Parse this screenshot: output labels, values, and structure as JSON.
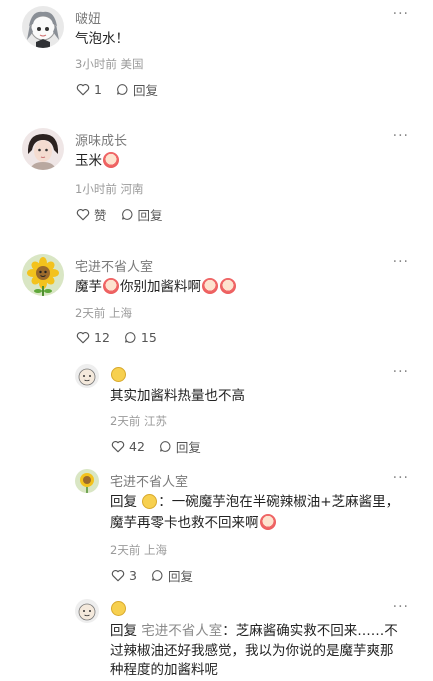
{
  "comments": [
    {
      "name": "啵妞",
      "text": "气泡水！",
      "time": "3小时前",
      "location": "美国",
      "likes": "1",
      "reply_label": "回复",
      "avatar": "anime-girl-avatar"
    },
    {
      "name": "源味成长",
      "text": "玉米",
      "time": "1小时前",
      "location": "河南",
      "likes": "赞",
      "reply_label": "回复",
      "avatar": "person-avatar"
    },
    {
      "name": "宅进不省人室",
      "text_part1": "魔芋",
      "text_part2": "你别加酱料啊",
      "time": "2天前",
      "location": "上海",
      "likes": "12",
      "replies": "15",
      "avatar": "sunflower-avatar"
    }
  ],
  "replies": [
    {
      "text": "其实加酱料热量也不高",
      "time": "2天前",
      "location": "江苏",
      "likes": "42",
      "reply_label": "回复"
    },
    {
      "name": "宅进不省人室",
      "reply_prefix": "回复",
      "line1": "：一碗魔芋泡在半碗辣椒油+芝麻酱里，",
      "line2": "魔芋再零卡也救不回来啊",
      "time": "2天前",
      "location": "上海",
      "likes": "3",
      "reply_label": "回复"
    },
    {
      "reply_prefix": "回复",
      "reply_target": "宅进不省人室",
      "line1": "：芝麻酱确实救不回来……不",
      "line2": "过辣椒油还好我感觉，我以为你说的是魔芋爽那",
      "line3": "种程度的加酱料呢"
    }
  ],
  "more_icon": "···"
}
